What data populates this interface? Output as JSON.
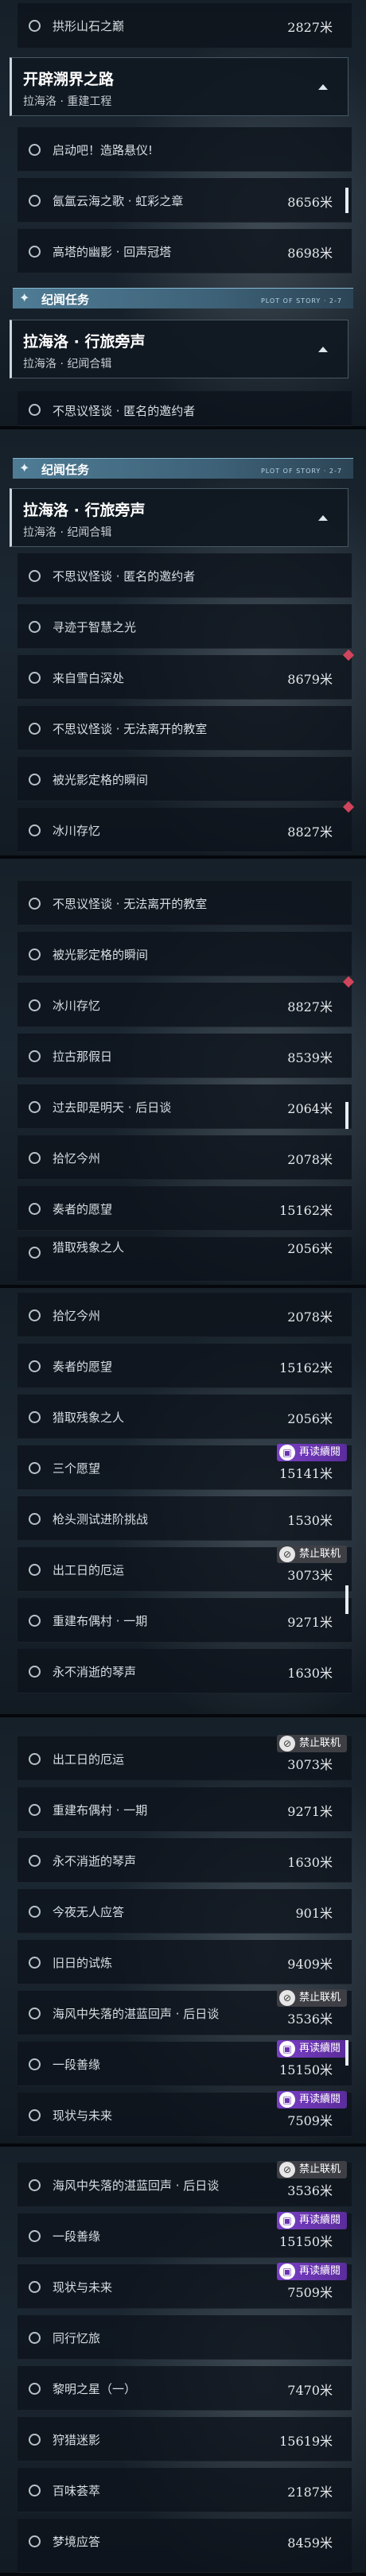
{
  "icons": {
    "radio": "radio-circle-icon",
    "diamond": "red-diamond-marker-icon",
    "star": "four-point-star-icon",
    "collapse": "chevron-up-icon",
    "bilibili": "bilibili-tv-icon",
    "nolink": "no-multiplayer-icon"
  },
  "colors": {
    "accent": "#4f7c95",
    "marker": "#d0455b",
    "badge_purple": "#7a3fc7",
    "badge_dark": "#3e3f45"
  },
  "badges": {
    "continue_reading": "再读續閱",
    "no_coop": "禁止联机"
  },
  "panels": [
    {
      "items": [
        {
          "label": "拱形山石之巅",
          "value": "2827米"
        },
        {
          "label": "启动吧！造路悬仪!",
          "value": ""
        },
        {
          "label": "氤氲云海之歌 · 虹彩之章",
          "value": "8656米"
        },
        {
          "label": "高塔的幽影 · 回声冠塔",
          "value": "8698米"
        }
      ],
      "header": {
        "title": "开辟溯界之路",
        "subtitle": "拉海洛 · 重建工程"
      },
      "section": {
        "title": "纪闻任务",
        "deco": "PLOT OF STORY · 2-7"
      },
      "header2": {
        "title": "拉海洛 · 行旅旁声",
        "subtitle": "拉海洛 · 纪闻合辑"
      },
      "partial": {
        "label": "不思议怪谈 · 匿名的邀约者"
      }
    },
    {
      "section": {
        "title": "纪闻任务",
        "deco": "PLOT OF STORY · 2-7"
      },
      "header": {
        "title": "拉海洛 · 行旅旁声",
        "subtitle": "拉海洛 · 纪闻合辑"
      },
      "items": [
        {
          "label": "不思议怪谈 · 匿名的邀约者",
          "value": ""
        },
        {
          "label": "寻迹于智慧之光",
          "value": ""
        },
        {
          "label": "来自雪白深处",
          "value": "8679米"
        },
        {
          "label": "不思议怪谈 · 无法离开的教室",
          "value": ""
        },
        {
          "label": "被光影定格的瞬间",
          "value": ""
        },
        {
          "label": "冰川存忆",
          "value": "8827米"
        }
      ]
    },
    {
      "items": [
        {
          "label": "不思议怪谈 · 无法离开的教室",
          "value": ""
        },
        {
          "label": "被光影定格的瞬间",
          "value": ""
        },
        {
          "label": "冰川存忆",
          "value": "8827米"
        },
        {
          "label": "拉古那假日",
          "value": "8539米"
        },
        {
          "label": "过去即是明天 · 后日谈",
          "value": "2064米"
        },
        {
          "label": "拾忆今州",
          "value": "2078米"
        },
        {
          "label": "奏者的愿望",
          "value": "15162米"
        },
        {
          "label": "猎取残象之人",
          "value": "2056米"
        }
      ]
    },
    {
      "items": [
        {
          "label": "拾忆今州",
          "value": "2078米"
        },
        {
          "label": "奏者的愿望",
          "value": "15162米"
        },
        {
          "label": "猎取残象之人",
          "value": "2056米"
        },
        {
          "label": "三个愿望",
          "value": "15141米"
        },
        {
          "label": "枪头测试进阶挑战",
          "value": "1530米"
        },
        {
          "label": "出工日的厄运",
          "value": "3073米"
        },
        {
          "label": "重建布偶村 · 一期",
          "value": "9271米"
        },
        {
          "label": "永不消逝的琴声",
          "value": "1630米"
        }
      ]
    },
    {
      "items": [
        {
          "label": "出工日的厄运",
          "value": "3073米"
        },
        {
          "label": "重建布偶村 · 一期",
          "value": "9271米"
        },
        {
          "label": "永不消逝的琴声",
          "value": "1630米"
        },
        {
          "label": "今夜无人应答",
          "value": "901米"
        },
        {
          "label": "旧日的试炼",
          "value": "9409米"
        },
        {
          "label": "海风中失落的湛蓝回声 · 后日谈",
          "value": "3536米"
        },
        {
          "label": "一段善缘",
          "value": "15150米"
        },
        {
          "label": "现状与未来",
          "value": "7509米"
        }
      ]
    },
    {
      "items": [
        {
          "label": "海风中失落的湛蓝回声 · 后日谈",
          "value": "3536米"
        },
        {
          "label": "一段善缘",
          "value": "15150米"
        },
        {
          "label": "现状与未来",
          "value": "7509米"
        },
        {
          "label": "同行忆旅",
          "value": ""
        },
        {
          "label": "黎明之星（一）",
          "value": "7470米"
        },
        {
          "label": "狩猎迷影",
          "value": "15619米"
        },
        {
          "label": "百味荟萃",
          "value": "2187米"
        },
        {
          "label": "梦境应答",
          "value": "8459米"
        }
      ]
    }
  ]
}
